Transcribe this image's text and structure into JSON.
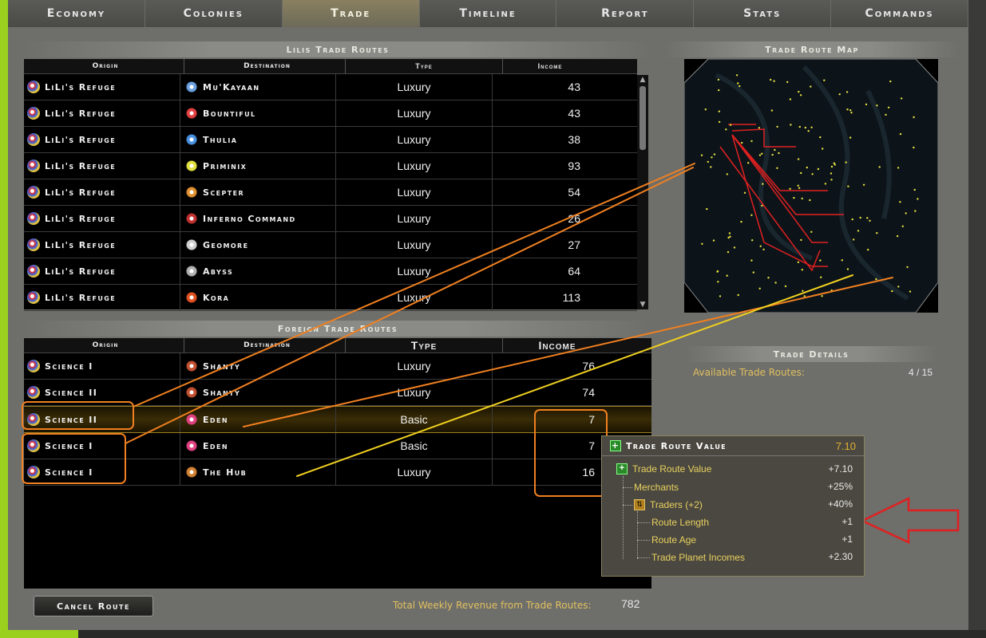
{
  "tabs": [
    {
      "label": "Economy",
      "active": false
    },
    {
      "label": "Colonies",
      "active": false
    },
    {
      "label": "Trade",
      "active": true
    },
    {
      "label": "Timeline",
      "active": false
    },
    {
      "label": "Report",
      "active": false
    },
    {
      "label": "Stats",
      "active": false
    },
    {
      "label": "Commands",
      "active": false
    }
  ],
  "own_routes": {
    "title": "Lilis Trade Routes",
    "headers": [
      "Origin",
      "Destination",
      "Type",
      "Income"
    ],
    "rows": [
      {
        "origin": "LiLi's Refuge",
        "destination": "Mu'Kayaan",
        "type": "Luxury",
        "income": "43",
        "dest_color": "#6aa0e0"
      },
      {
        "origin": "LiLi's Refuge",
        "destination": "Bountiful",
        "type": "Luxury",
        "income": "43",
        "dest_color": "#e04040"
      },
      {
        "origin": "LiLi's Refuge",
        "destination": "Thulia",
        "type": "Luxury",
        "income": "38",
        "dest_color": "#4a90e0"
      },
      {
        "origin": "LiLi's Refuge",
        "destination": "Priminix",
        "type": "Luxury",
        "income": "93",
        "dest_color": "#e0e040"
      },
      {
        "origin": "LiLi's Refuge",
        "destination": "Scepter",
        "type": "Luxury",
        "income": "54",
        "dest_color": "#e09030"
      },
      {
        "origin": "LiLi's Refuge",
        "destination": "Inferno Command",
        "type": "Luxury",
        "income": "26",
        "dest_color": "#c03030"
      },
      {
        "origin": "LiLi's Refuge",
        "destination": "Geomore",
        "type": "Luxury",
        "income": "27",
        "dest_color": "#d0d0d0"
      },
      {
        "origin": "LiLi's Refuge",
        "destination": "Abyss",
        "type": "Luxury",
        "income": "64",
        "dest_color": "#b0b0b0"
      },
      {
        "origin": "LiLi's Refuge",
        "destination": "Kora",
        "type": "Luxury",
        "income": "113",
        "dest_color": "#e05020"
      }
    ]
  },
  "foreign_routes": {
    "title": "Foreign Trade Routes",
    "headers": [
      "Origin",
      "Destination",
      "Type",
      "Income"
    ],
    "rows": [
      {
        "origin": "Science I",
        "destination": "Shanty",
        "type": "Luxury",
        "income": "76",
        "dest_color": "#c05030",
        "selected": false
      },
      {
        "origin": "Science II",
        "destination": "Shanty",
        "type": "Luxury",
        "income": "74",
        "dest_color": "#c05030",
        "selected": false
      },
      {
        "origin": "Science II",
        "destination": "Eden",
        "type": "Basic",
        "income": "7",
        "dest_color": "#e04080",
        "selected": true
      },
      {
        "origin": "Science I",
        "destination": "Eden",
        "type": "Basic",
        "income": "7",
        "dest_color": "#e04080",
        "selected": false
      },
      {
        "origin": "Science I",
        "destination": "The Hub",
        "type": "Luxury",
        "income": "16",
        "dest_color": "#d08030",
        "selected": false
      }
    ]
  },
  "map": {
    "title": "Trade Route Map"
  },
  "details": {
    "title": "Trade Details",
    "available_label": "Available Trade Routes:",
    "available_value": "4 / 15"
  },
  "tooltip": {
    "title": "Trade Route Value",
    "title_value": "7.10",
    "rows": [
      {
        "label": "Trade Route Value",
        "value": "+7.10"
      },
      {
        "label": "Merchants",
        "value": "+25%"
      },
      {
        "label": "Traders (+2)",
        "value": "+40%"
      },
      {
        "label": "Route Length",
        "value": "+1"
      },
      {
        "label": "Route Age",
        "value": "+1"
      },
      {
        "label": "Trade Planet Incomes",
        "value": "+2.30"
      }
    ]
  },
  "footer": {
    "cancel_label": "Cancel Route",
    "total_label": "Total Weekly Revenue from Trade Routes:",
    "total_value": "782"
  },
  "colors": {
    "accent": "#e0c060",
    "annotation_orange": "#f08020",
    "annotation_yellow": "#f0d020",
    "annotation_red": "#e02020"
  }
}
